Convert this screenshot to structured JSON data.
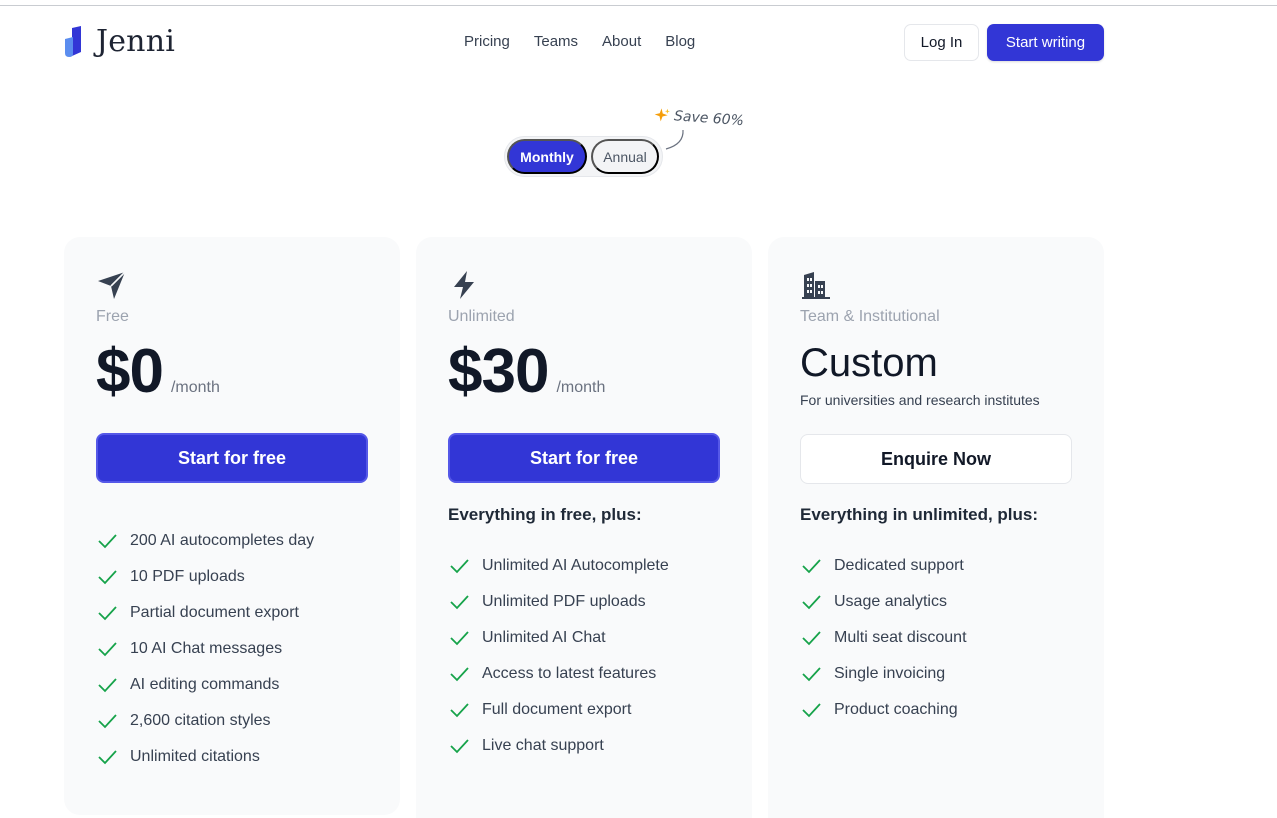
{
  "brand": {
    "name": "Jenni",
    "accent": "#3236d6"
  },
  "nav": [
    {
      "label": "Pricing"
    },
    {
      "label": "Teams"
    },
    {
      "label": "About"
    },
    {
      "label": "Blog"
    }
  ],
  "header": {
    "login_label": "Log In",
    "start_label": "Start writing"
  },
  "billing": {
    "monthly": "Monthly",
    "annual": "Annual",
    "selected": "Monthly",
    "save_badge": "Save 60%"
  },
  "plans": [
    {
      "icon": "paper-plane-icon",
      "name": "Free",
      "price": "$0",
      "period": "/month",
      "cta": "Start for free",
      "features": [
        "200 AI autocompletes day",
        "10 PDF uploads",
        "Partial document export",
        "10 AI Chat messages",
        "AI editing commands",
        "2,600 citation styles",
        "Unlimited citations"
      ]
    },
    {
      "icon": "lightning-icon",
      "name": "Unlimited",
      "price": "$30",
      "period": "/month",
      "cta": "Start for free",
      "includes": "Everything in free, plus:",
      "features": [
        "Unlimited AI Autocomplete",
        "Unlimited PDF uploads",
        "Unlimited AI Chat",
        "Access to latest features",
        "Full document export",
        "Live chat support"
      ]
    },
    {
      "icon": "building-icon",
      "name": "Team & Institutional",
      "price": "Custom",
      "subtitle": "For universities and research institutes",
      "cta": "Enquire Now",
      "includes": "Everything in unlimited, plus:",
      "features": [
        "Dedicated support",
        "Usage analytics",
        "Multi seat discount",
        "Single invoicing",
        "Product coaching"
      ]
    }
  ],
  "colors": {
    "check": "#16a34a",
    "card_bg": "#f9fafb",
    "muted": "#9ca3af"
  }
}
